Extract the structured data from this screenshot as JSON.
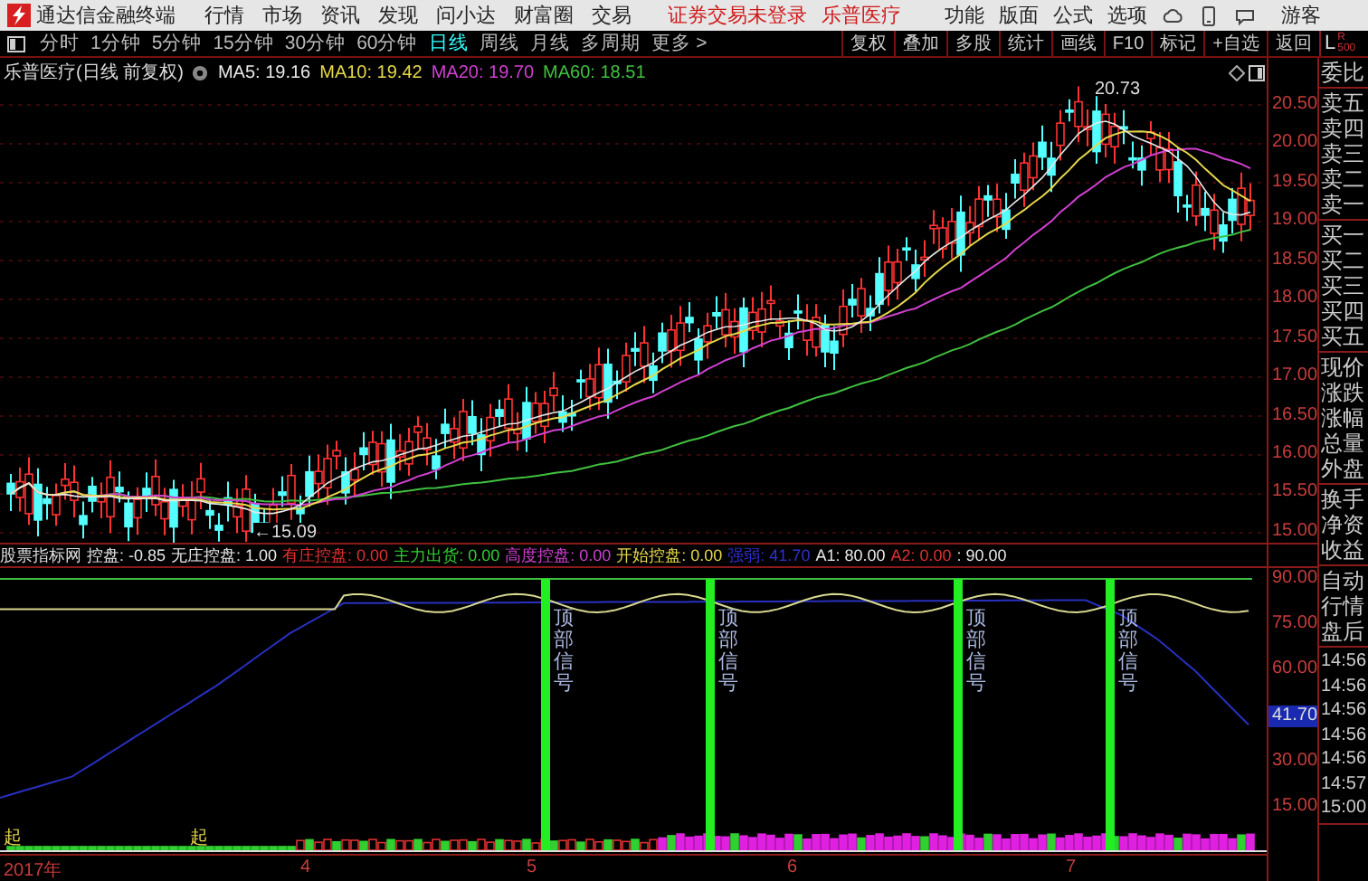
{
  "menubar": {
    "app_title": "通达信金融终端",
    "menus": [
      "行情",
      "市场",
      "资讯",
      "发现",
      "问小达",
      "财富圈",
      "交易"
    ],
    "notices": [
      "证券交易未登录",
      "乐普医疗"
    ],
    "right_menus": [
      "功能",
      "版面",
      "公式",
      "选项"
    ],
    "user": "游客"
  },
  "toolbar": {
    "periods": [
      {
        "label": "分时",
        "selected": false
      },
      {
        "label": "1分钟",
        "selected": false
      },
      {
        "label": "5分钟",
        "selected": false
      },
      {
        "label": "15分钟",
        "selected": false
      },
      {
        "label": "30分钟",
        "selected": false
      },
      {
        "label": "60分钟",
        "selected": false
      },
      {
        "label": "日线",
        "selected": true
      },
      {
        "label": "周线",
        "selected": false
      },
      {
        "label": "月线",
        "selected": false
      },
      {
        "label": "多周期",
        "selected": false
      },
      {
        "label": "更多 >",
        "selected": false
      }
    ],
    "actions": [
      "复权",
      "叠加",
      "多股",
      "统计",
      "画线",
      "F10",
      "标记",
      "+自选",
      "返回"
    ],
    "corner": [
      "L",
      "R",
      "500"
    ]
  },
  "price_pane": {
    "title": "乐普医疗(日线 前复权)",
    "ma": [
      {
        "label": "MA5: 19.16",
        "color": "#e8e8e8"
      },
      {
        "label": "MA10: 19.42",
        "color": "#e6d84a"
      },
      {
        "label": "MA20: 19.70",
        "color": "#d040d0"
      },
      {
        "label": "MA60: 18.51",
        "color": "#40c040"
      }
    ],
    "high_label": "20.73",
    "low_label": "←15.09",
    "axis": [
      "20.50",
      "20.00",
      "19.50",
      "19.00",
      "18.50",
      "18.00",
      "17.50",
      "17.00",
      "16.50",
      "16.00",
      "15.50",
      "15.00"
    ]
  },
  "indicator_pane": {
    "title": "股票指标网",
    "values": [
      {
        "label": "控盘: -0.85",
        "color": "#e8e8e8"
      },
      {
        "label": "无庄控盘: 1.00",
        "color": "#e8e8e8"
      },
      {
        "label": "有庄控盘: 0.00",
        "color": "#e03030"
      },
      {
        "label": "主力出货: 0.00",
        "color": "#30d030"
      },
      {
        "label": "高度控盘: 0.00",
        "color": "#d040d0"
      },
      {
        "label": "开始控盘: 0.00",
        "color": "#e6d84a"
      },
      {
        "label": "强弱: 41.70",
        "color": "#3030d0"
      },
      {
        "label": "A1: 80.00",
        "color": "#e8e8e8"
      },
      {
        "label": "A2: 0.00",
        "color": "#e03030"
      },
      {
        "label": ": 90.00",
        "color": "#e8e8e8"
      }
    ],
    "signals": [
      "顶部信号",
      "顶部信号",
      "顶部信号",
      "顶部信号"
    ],
    "start_marks": [
      "起",
      "起"
    ],
    "axis": [
      {
        "label": "90.00",
        "highlight": false
      },
      {
        "label": "75.00",
        "highlight": false
      },
      {
        "label": "60.00",
        "highlight": false
      },
      {
        "label": "41.70",
        "highlight": true
      },
      {
        "label": "30.00",
        "highlight": false
      },
      {
        "label": "15.00",
        "highlight": false
      }
    ]
  },
  "date_axis": [
    "2017年",
    "4",
    "5",
    "6",
    "7"
  ],
  "quote_panel": {
    "groups": [
      [
        "委比"
      ],
      [
        "卖五",
        "卖四",
        "卖三",
        "卖二",
        "卖一"
      ],
      [
        "买一",
        "买二",
        "买三",
        "买四",
        "买五"
      ],
      [
        "现价",
        "涨跌",
        "涨幅",
        "总量",
        "外盘"
      ],
      [
        "换手",
        "净资",
        "收益"
      ],
      [
        "自动",
        "行情",
        "盘后"
      ],
      [
        "14:56",
        "14:56",
        "14:56",
        "14:56",
        "14:56",
        "14:57",
        "15:00"
      ]
    ]
  }
}
